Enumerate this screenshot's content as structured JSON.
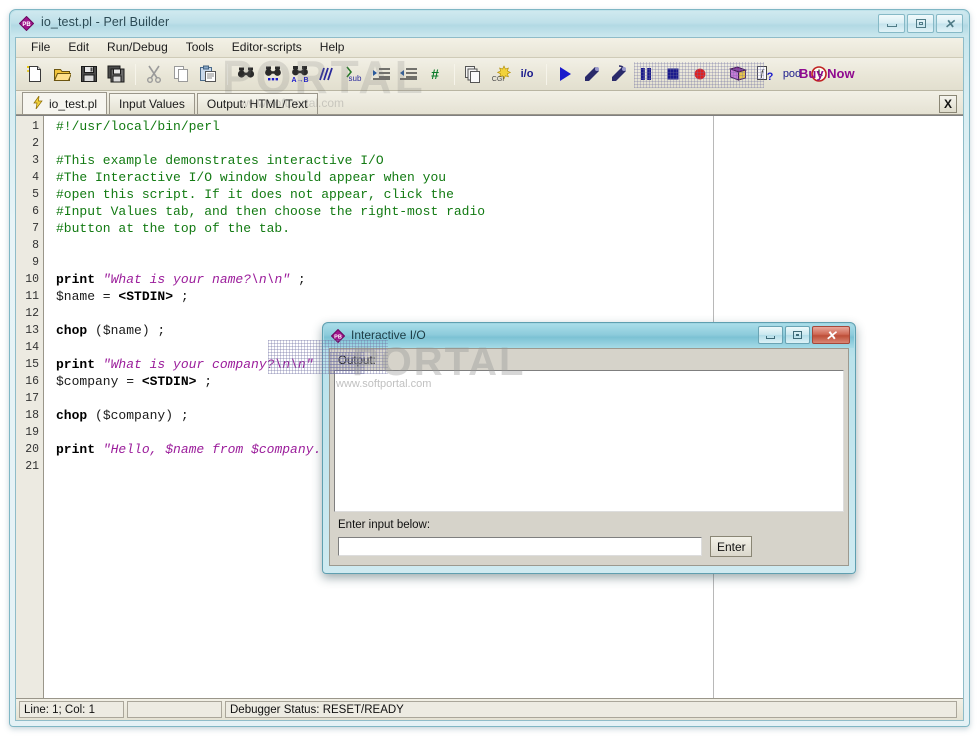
{
  "window": {
    "title": "io_test.pl - Perl Builder",
    "icon": "perl-builder-icon",
    "controls": {
      "minimize": "–",
      "maximize": "□",
      "close": "✕"
    }
  },
  "menubar": {
    "items": [
      {
        "label": "File",
        "name": "menu-file"
      },
      {
        "label": "Edit",
        "name": "menu-edit"
      },
      {
        "label": "Run/Debug",
        "name": "menu-run-debug"
      },
      {
        "label": "Tools",
        "name": "menu-tools"
      },
      {
        "label": "Editor-scripts",
        "name": "menu-editor-scripts"
      },
      {
        "label": "Help",
        "name": "menu-help"
      }
    ]
  },
  "toolbar": {
    "buy_now_label": "Buy Now",
    "buy_now_color": "#8f0a8f",
    "buttons": [
      {
        "name": "new-file-icon",
        "glyph": "new"
      },
      {
        "name": "open-file-icon",
        "glyph": "open"
      },
      {
        "name": "save-file-icon",
        "glyph": "save"
      },
      {
        "name": "save-all-icon",
        "glyph": "saveall"
      },
      {
        "name": "separator-1",
        "glyph": "sep"
      },
      {
        "name": "cut-icon",
        "glyph": "cut"
      },
      {
        "name": "copy-icon",
        "glyph": "copy"
      },
      {
        "name": "paste-icon",
        "glyph": "paste"
      },
      {
        "name": "separator-2",
        "glyph": "sep"
      },
      {
        "name": "find-icon",
        "glyph": "find"
      },
      {
        "name": "find-next-icon",
        "glyph": "findnext"
      },
      {
        "name": "replace-icon",
        "glyph": "replace"
      },
      {
        "name": "comment-icon",
        "glyph": "slashes"
      },
      {
        "name": "insert-sub-icon",
        "glyph": "sub",
        "text": "sub"
      },
      {
        "name": "indent-icon",
        "glyph": "indent"
      },
      {
        "name": "outdent-icon",
        "glyph": "outdent"
      },
      {
        "name": "line-numbers-icon",
        "glyph": "hash",
        "text": "#"
      },
      {
        "name": "separator-3",
        "glyph": "sep"
      },
      {
        "name": "duplicate-icon",
        "glyph": "dup"
      },
      {
        "name": "cgi-wizard-icon",
        "glyph": "cgi",
        "text": "CGI"
      },
      {
        "name": "io-window-icon",
        "glyph": "io",
        "text": "i/o"
      },
      {
        "name": "separator-4",
        "glyph": "sep"
      },
      {
        "name": "run-icon",
        "glyph": "play"
      },
      {
        "name": "step-over-icon",
        "glyph": "step"
      },
      {
        "name": "step-into-icon",
        "glyph": "stepinto"
      },
      {
        "name": "pause-icon",
        "glyph": "pause"
      },
      {
        "name": "stop-icon",
        "glyph": "stop"
      },
      {
        "name": "record-breakpoint-icon",
        "glyph": "record"
      },
      {
        "name": "separator-5",
        "glyph": "sep"
      },
      {
        "name": "help-book-icon",
        "glyph": "book"
      },
      {
        "name": "function-help-icon",
        "glyph": "fhelp",
        "text": "f?"
      },
      {
        "name": "pod-icon",
        "glyph": "pod",
        "text": "pod"
      },
      {
        "name": "timer-icon",
        "glyph": "clock"
      }
    ]
  },
  "tabs": {
    "items": [
      {
        "label": "io_test.pl",
        "name": "tab-io-test-pl",
        "active": true,
        "icon": "lightning-icon"
      },
      {
        "label": "Input Values",
        "name": "tab-input-values",
        "active": false
      },
      {
        "label": "Output: HTML/Text",
        "name": "tab-output-html-text",
        "active": false
      }
    ],
    "close_label": "X"
  },
  "editor": {
    "line_numbers": [
      "1",
      "2",
      "3",
      "4",
      "5",
      "6",
      "7",
      "8",
      "9",
      "10",
      "11",
      "12",
      "13",
      "14",
      "15",
      "16",
      "17",
      "18",
      "19",
      "20",
      "21"
    ],
    "lines": [
      {
        "n": 1,
        "segments": [
          {
            "t": "#!/usr/local/bin/perl",
            "c": "comment"
          }
        ]
      },
      {
        "n": 2,
        "segments": []
      },
      {
        "n": 3,
        "segments": [
          {
            "t": "#This example demonstrates interactive I/O",
            "c": "comment"
          }
        ]
      },
      {
        "n": 4,
        "segments": [
          {
            "t": "#The Interactive I/O window should appear when you",
            "c": "comment"
          }
        ]
      },
      {
        "n": 5,
        "segments": [
          {
            "t": "#open this script. If it does not appear, click the",
            "c": "comment"
          }
        ]
      },
      {
        "n": 6,
        "segments": [
          {
            "t": "#Input Values tab, and then choose the right-most radio",
            "c": "comment"
          }
        ]
      },
      {
        "n": 7,
        "segments": [
          {
            "t": "#button at the top of the tab.",
            "c": "comment"
          }
        ]
      },
      {
        "n": 8,
        "segments": []
      },
      {
        "n": 9,
        "segments": []
      },
      {
        "n": 10,
        "segments": [
          {
            "t": "print ",
            "c": "kw"
          },
          {
            "t": "\"What is your name?\\n\\n\"",
            "c": "str"
          },
          {
            "t": " ;",
            "c": "plain"
          }
        ]
      },
      {
        "n": 11,
        "segments": [
          {
            "t": "$name = ",
            "c": "plain"
          },
          {
            "t": "<STDIN>",
            "c": "kw"
          },
          {
            "t": " ;",
            "c": "plain"
          }
        ]
      },
      {
        "n": 12,
        "segments": []
      },
      {
        "n": 13,
        "segments": [
          {
            "t": "chop ",
            "c": "kw"
          },
          {
            "t": "($name) ;",
            "c": "plain"
          }
        ]
      },
      {
        "n": 14,
        "segments": []
      },
      {
        "n": 15,
        "segments": [
          {
            "t": "print ",
            "c": "kw"
          },
          {
            "t": "\"What is your company?\\n\\n\"",
            "c": "str"
          },
          {
            "t": " ;",
            "c": "plain"
          }
        ]
      },
      {
        "n": 16,
        "segments": [
          {
            "t": "$company = ",
            "c": "plain"
          },
          {
            "t": "<STDIN>",
            "c": "kw"
          },
          {
            "t": " ;",
            "c": "plain"
          }
        ]
      },
      {
        "n": 17,
        "segments": []
      },
      {
        "n": 18,
        "segments": [
          {
            "t": "chop ",
            "c": "kw"
          },
          {
            "t": "($company) ;",
            "c": "plain"
          }
        ]
      },
      {
        "n": 19,
        "segments": []
      },
      {
        "n": 20,
        "segments": [
          {
            "t": "print ",
            "c": "kw"
          },
          {
            "t": "\"Hello, $name from $company.\\n\\n\"",
            "c": "str"
          },
          {
            "t": " ;",
            "c": "plain"
          }
        ]
      },
      {
        "n": 21,
        "segments": []
      }
    ],
    "colors": {
      "comment": "#127a12",
      "keyword": "#000000",
      "string": "#9b1d9b",
      "plain": "#1a1a1a"
    }
  },
  "statusbar": {
    "position": "Line: 1; Col: 1",
    "middle": "",
    "debugger": "Debugger Status: RESET/READY"
  },
  "dialog": {
    "title": "Interactive I/O",
    "icon": "perl-builder-icon",
    "output_label": "Output:",
    "output_text": "",
    "input_label": "Enter input below:",
    "input_value": "",
    "input_placeholder": "",
    "enter_label": "Enter",
    "controls": {
      "minimize": "–",
      "maximize": "□",
      "close": "✕"
    }
  },
  "watermarks": {
    "portal": "PORTAL",
    "url": "www.softportal.com"
  }
}
